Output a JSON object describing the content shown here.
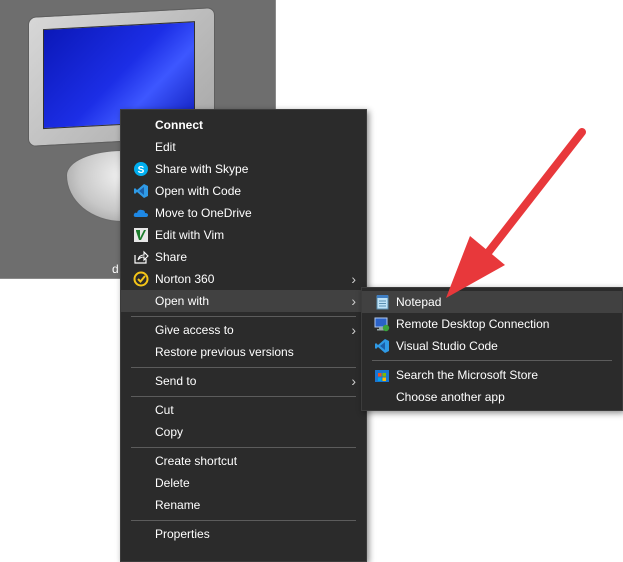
{
  "desktop_icon": {
    "label": "d"
  },
  "context_menu": {
    "items": [
      {
        "label": "Connect",
        "icon": "none",
        "bold": true
      },
      {
        "label": "Edit",
        "icon": "none"
      },
      {
        "label": "Share with Skype",
        "icon": "skype-icon"
      },
      {
        "label": "Open with Code",
        "icon": "vscode-icon"
      },
      {
        "label": "Move to OneDrive",
        "icon": "onedrive-icon"
      },
      {
        "label": "Edit with Vim",
        "icon": "vim-icon"
      },
      {
        "label": "Share",
        "icon": "share-icon"
      },
      {
        "label": "Norton 360",
        "icon": "norton-icon",
        "submenu": true
      },
      {
        "label": "Open with",
        "icon": "none",
        "submenu": true,
        "highlighted": true
      },
      {
        "label": "Give access to",
        "icon": "none",
        "submenu": true
      },
      {
        "label": "Restore previous versions",
        "icon": "none"
      },
      {
        "label": "Send to",
        "icon": "none",
        "submenu": true
      },
      {
        "label": "Cut",
        "icon": "none"
      },
      {
        "label": "Copy",
        "icon": "none"
      },
      {
        "label": "Create shortcut",
        "icon": "none"
      },
      {
        "label": "Delete",
        "icon": "none"
      },
      {
        "label": "Rename",
        "icon": "none"
      },
      {
        "label": "Properties",
        "icon": "none"
      }
    ],
    "arrow_glyph": "›"
  },
  "open_with_submenu": {
    "items": [
      {
        "label": "Notepad",
        "icon": "notepad-icon",
        "highlighted": true
      },
      {
        "label": "Remote Desktop Connection",
        "icon": "remote-desktop-icon"
      },
      {
        "label": "Visual Studio Code",
        "icon": "vscode-icon"
      },
      {
        "label": "Search the Microsoft Store",
        "icon": "store-icon"
      },
      {
        "label": "Choose another app",
        "icon": "none"
      }
    ]
  },
  "colors": {
    "menu_bg": "#2b2b2b",
    "menu_highlight": "#414141",
    "separator": "#5c5c5c",
    "annotation_arrow": "#e8383b"
  }
}
